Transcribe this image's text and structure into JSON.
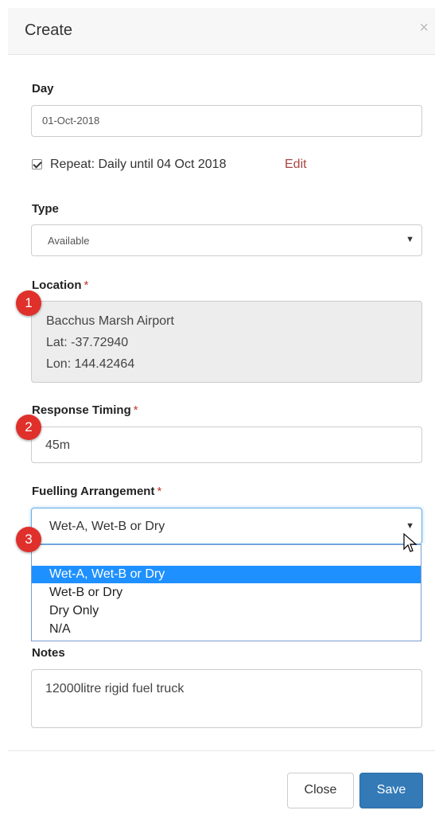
{
  "modal": {
    "title": "Create",
    "close_glyph": "×"
  },
  "day": {
    "label": "Day",
    "value": "01-Oct-2018"
  },
  "repeat": {
    "checked": true,
    "text": "Repeat: Daily until 04 Oct 2018",
    "edit_label": "Edit"
  },
  "type": {
    "label": "Type",
    "value": "Available"
  },
  "location": {
    "label": "Location",
    "required_mark": "*",
    "name": "Bacchus Marsh Airport",
    "lat": "Lat: -37.72940",
    "lon": "Lon: 144.42464"
  },
  "response_timing": {
    "label": "Response Timing",
    "required_mark": "*",
    "value": "45m"
  },
  "fuelling": {
    "label": "Fuelling Arrangement",
    "required_mark": "*",
    "value": "Wet-A, Wet-B or Dry",
    "options": [
      "Wet-A, Wet-B or Dry",
      "Wet-B or Dry",
      "Dry Only",
      "N/A"
    ],
    "selected_index": 0
  },
  "notes": {
    "label": "Notes",
    "value": "12000litre rigid fuel truck"
  },
  "annotations": [
    "1",
    "2",
    "3"
  ],
  "footer": {
    "close_label": "Close",
    "save_label": "Save"
  },
  "colors": {
    "primary": "#337ab7",
    "selected_option": "#1e90ff",
    "badge": "#e0302b",
    "edit_link": "#a94442",
    "required": "#c0392b"
  },
  "icons": {
    "caret": "caret-down-icon",
    "close": "close-icon",
    "cursor": "mouse-pointer-icon"
  }
}
